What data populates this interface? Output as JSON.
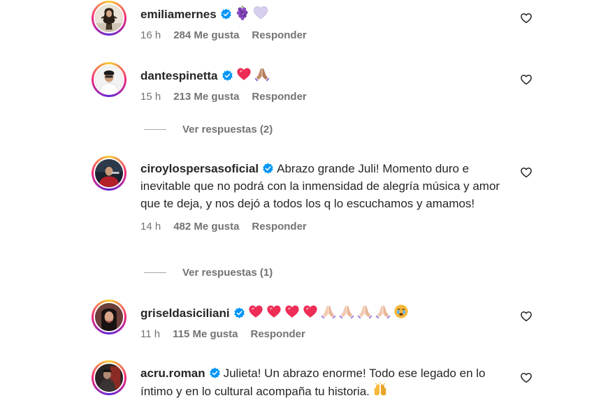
{
  "comments": [
    {
      "username": "emiliamernes",
      "text": "",
      "time": "16 h",
      "likes": "284 Me gusta",
      "reply": "Responder"
    },
    {
      "username": "dantespinetta",
      "text": "",
      "time": "15 h",
      "likes": "213 Me gusta",
      "reply": "Responder",
      "view_replies": "Ver respuestas (2)"
    },
    {
      "username": "ciroylospersasoficial",
      "text": "Abrazo grande Juli! Momento duro e inevitable que no podrá con la inmensidad de alegría música y amor que te deja, y nos dejó a todos los q lo escuchamos y amamos!",
      "time": "14 h",
      "likes": "482 Me gusta",
      "reply": "Responder",
      "view_replies": "Ver respuestas (1)"
    },
    {
      "username": "griseldasiciliani",
      "text": "",
      "time": "11 h",
      "likes": "115 Me gusta",
      "reply": "Responder"
    },
    {
      "username": "acru.roman",
      "text": "Julieta! Un abrazo enorme! Todo ese legado en lo íntimo y en lo cultural acompaña tu historia."
    }
  ],
  "colors": {
    "verified": "#0095f6",
    "meta_text": "#737373",
    "heart_red": "#ed2d55"
  },
  "icons": {
    "verified": "verified-badge-icon",
    "like": "heart-outline-icon"
  }
}
